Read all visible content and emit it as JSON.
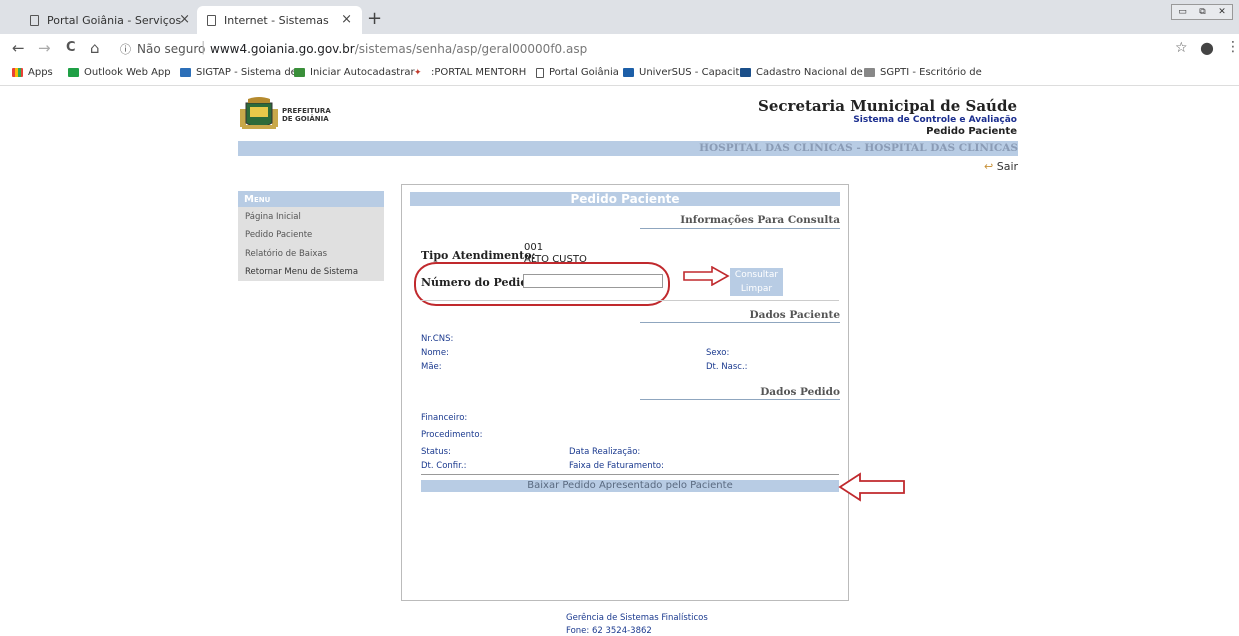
{
  "browser": {
    "tabs": [
      {
        "title": "Portal Goiânia - Serviços",
        "close": "×"
      },
      {
        "title": "Internet - Sistemas",
        "close": "×"
      }
    ],
    "new_tab": "+",
    "window_controls": [
      "▭",
      "⧉",
      "✕"
    ],
    "nav": {
      "back": "←",
      "forward": "→",
      "reload": "C",
      "home": "⌂",
      "star": "☆",
      "account": "●",
      "menu": "⋮"
    },
    "info_icon": "ⓘ",
    "not_secure": "Não seguro",
    "url_host": "www4.goiania.go.gov.br",
    "url_path": "/sistemas/senha/asp/geral00000f0.asp",
    "bookmarks": [
      {
        "label": "Apps",
        "color": "#e94235"
      },
      {
        "label": "Outlook Web App",
        "color": "#1fa046"
      },
      {
        "label": "SIGTAP - Sistema de",
        "color": "#2c6fb8"
      },
      {
        "label": "Iniciar Autocadastrar",
        "color": "#3a8f3a"
      },
      {
        "label": ":PORTAL MENTORH",
        "color": "#c0392b"
      },
      {
        "label": "Portal Goiânia",
        "color": "#ffffff"
      },
      {
        "label": "UniverSUS - Capacita",
        "color": "#1d5fa8"
      },
      {
        "label": "Cadastro Nacional de",
        "color": "#1b4f8a"
      },
      {
        "label": "SGPTI - Escritório de",
        "color": "#888888"
      }
    ]
  },
  "header": {
    "logo_line1": "PREFEITURA",
    "logo_line2": "DE GOIÂNIA",
    "title": "Secretaria Municipal de Saúde",
    "subtitle": "Sistema de Controle e Avaliação",
    "page": "Pedido Paciente",
    "hospital": "HOSPITAL DAS CLINICAS - HOSPITAL DAS CLINICAS",
    "sair": "Sair",
    "sair_icon": "↩"
  },
  "menu": {
    "title": "Menu",
    "items": [
      "Página Inicial",
      "Pedido Paciente",
      "Relatório de Baixas",
      "Retornar Menu de Sistema"
    ]
  },
  "main": {
    "title": "Pedido Paciente",
    "section_consulta": "Informações Para Consulta",
    "tipo_label": "Tipo Atendimento:",
    "tipo_code": "001",
    "tipo_desc": "ALTO CUSTO",
    "numero_label": "Número do Pedido:",
    "numero_value": "",
    "btn_consultar": "Consultar",
    "btn_limpar": "Limpar",
    "section_paciente": "Dados Paciente",
    "fields_paciente": {
      "cns": "Nr.CNS:",
      "nome": "Nome:",
      "sexo": "Sexo:",
      "mae": "Mãe:",
      "nasc": "Dt. Nasc.:"
    },
    "section_pedido": "Dados Pedido",
    "fields_pedido": {
      "financeiro": "Financeiro:",
      "procedimento": "Procedimento:",
      "status": "Status:",
      "data_realizacao": "Data Realização:",
      "dt_confir": "Dt. Confir.:",
      "faixa": "Faixa de Faturamento:"
    },
    "btn_baixar": "Baixar Pedido Apresentado pelo Paciente"
  },
  "footer": {
    "line1": "Gerência de Sistemas Finalísticos",
    "line2": "Fone: 62 3524-3862"
  },
  "colors": {
    "accent": "#b8cce4",
    "annotation": "#c0292d",
    "link": "#1b3a8f"
  }
}
